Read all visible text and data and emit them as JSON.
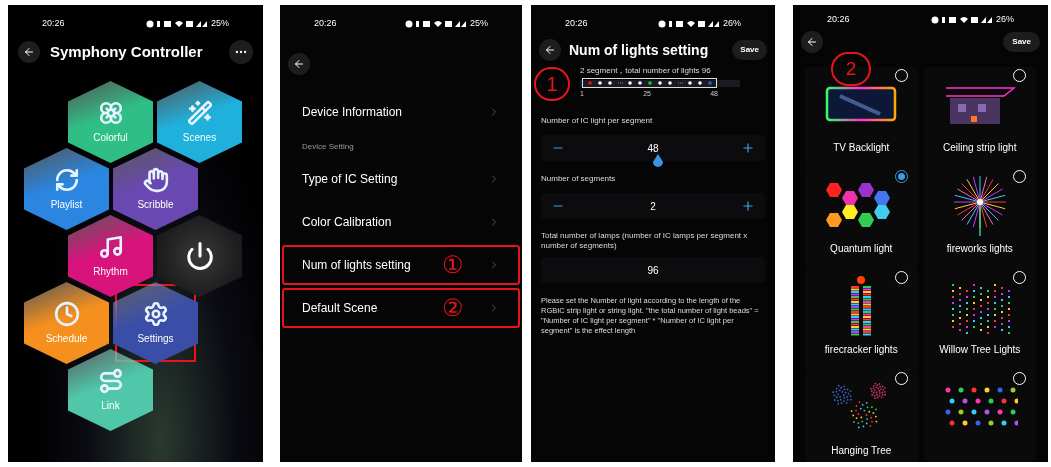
{
  "home_screen": {
    "status_bar": {
      "time": "20:26",
      "battery": "25%"
    },
    "title": "Symphony Controller",
    "tile_rows": [
      {
        "tiles": [
          {
            "kind": "colorful",
            "label": "Colorful",
            "color": "#2fbf86",
            "highlighted": false
          },
          {
            "kind": "scenes",
            "label": "Scenes",
            "color": "#1fb0dc",
            "highlighted": false
          }
        ]
      },
      {
        "tiles": [
          {
            "kind": "playlist",
            "label": "Playlist",
            "color": "#2a86e0",
            "highlighted": false
          },
          {
            "kind": "scribble",
            "label": "Scribble",
            "color": "#6a48b2",
            "highlighted": false
          }
        ]
      },
      {
        "tiles": [
          {
            "kind": "rhythm",
            "label": "Rhythm",
            "color": "#d8137c",
            "highlighted": false
          },
          {
            "kind": "power",
            "color": "#1c1c1e",
            "highlighted": false
          }
        ]
      },
      {
        "tiles": [
          {
            "kind": "schedule",
            "label": "Schedule",
            "color": "#f5901f",
            "highlighted": false
          },
          {
            "kind": "settings",
            "label": "Settings",
            "color": "#3a4ea8",
            "highlighted": true
          }
        ]
      },
      {
        "tiles": [
          {
            "kind": "link",
            "label": "Link",
            "color": "#4fc7a8",
            "highlighted": false
          }
        ]
      }
    ]
  },
  "settings_screen": {
    "status_bar": {
      "time": "20:26",
      "battery": "25%"
    },
    "items": [
      {
        "kind": "row",
        "label": "Device Information",
        "highlighted": false
      },
      {
        "kind": "section",
        "label": "Device Setting"
      },
      {
        "kind": "row",
        "label": "Type of IC Setting",
        "highlighted": false
      },
      {
        "kind": "row",
        "label": "Color Calibration",
        "highlighted": false
      },
      {
        "kind": "row",
        "label": "Num of lights setting",
        "highlighted": true,
        "annotation": "①"
      },
      {
        "kind": "row",
        "label": "Default Scene",
        "highlighted": true,
        "annotation": "②"
      }
    ]
  },
  "lights_screen": {
    "status_bar": {
      "time": "20:26",
      "battery": "26%"
    },
    "title": "Num of lights setting",
    "save_button": "Save",
    "annotation": "1",
    "summary": "2 segment，total number of lights 96",
    "strip_ticks": [
      "1",
      "25",
      "48"
    ],
    "steppers": [
      {
        "label": "Number of IC light per segment",
        "value": "48",
        "thumb": true
      },
      {
        "label": "Number of segments",
        "value": "2",
        "thumb": false
      }
    ],
    "total_label": "Total number of lamps (number of IC lamps per segment x number of segments)",
    "total_value": "96",
    "note": "Please set the Number of light according to the length of the RGBIC strip light or string light. \"the total number of light beads\" = \"Number of IC light per segment\" * \"Number of IC light per segment\" is the effect length"
  },
  "scene_screen": {
    "status_bar": {
      "time": "20:26",
      "battery": "26%"
    },
    "save_button": "Save",
    "annotation": "2",
    "scenes": [
      {
        "kind": "tv",
        "label": "TV Backlight",
        "selected": false
      },
      {
        "kind": "ceiling",
        "label": "Ceiling strip light",
        "selected": false
      },
      {
        "kind": "hexagons",
        "label": "Quantum light",
        "selected": true
      },
      {
        "kind": "burst",
        "label": "fireworks lights",
        "selected": false
      },
      {
        "kind": "firecracker",
        "label": "firecracker lights",
        "selected": false
      },
      {
        "kind": "willow",
        "label": "Willow Tree Lights",
        "selected": false
      },
      {
        "kind": "hanging",
        "label": "Hanging Tree",
        "selected": false
      },
      {
        "kind": "dots",
        "selected": false
      }
    ]
  }
}
